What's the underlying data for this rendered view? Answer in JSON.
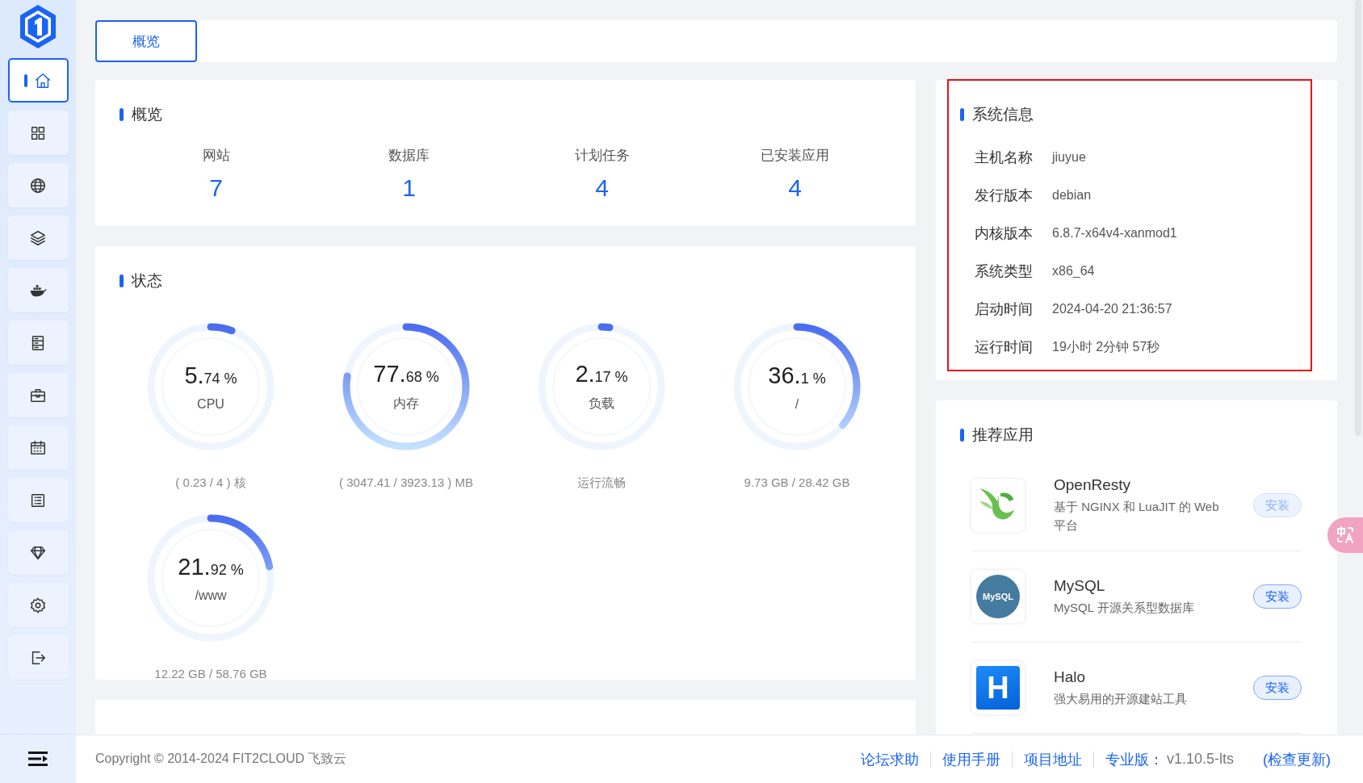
{
  "sidebar": {
    "items": [
      {
        "selected": true
      },
      {
        "selected": false
      },
      {
        "selected": false
      },
      {
        "selected": false
      },
      {
        "selected": false
      },
      {
        "selected": false
      },
      {
        "selected": false
      },
      {
        "selected": false
      },
      {
        "selected": false
      },
      {
        "selected": false
      },
      {
        "selected": false
      },
      {
        "selected": false
      }
    ]
  },
  "tabs": [
    {
      "label": "概览",
      "selected": true
    }
  ],
  "overview": {
    "title": "概览",
    "stats": [
      {
        "label": "网站",
        "value": "7"
      },
      {
        "label": "数据库",
        "value": "1"
      },
      {
        "label": "计划任务",
        "value": "4"
      },
      {
        "label": "已安装应用",
        "value": "4"
      }
    ]
  },
  "status": {
    "title": "状态",
    "gauges": [
      {
        "main": "5.",
        "fraction": "74 %",
        "label": "CPU",
        "detail": "( 0.23 / 4 ) 核",
        "level": 0.0574
      },
      {
        "main": "77.",
        "fraction": "68 %",
        "label": "内存",
        "detail": "( 3047.41 / 3923.13 ) MB",
        "level": 0.7768
      },
      {
        "main": "2.",
        "fraction": "17 %",
        "label": "负载",
        "detail": "运行流畅",
        "level": 0.0217
      },
      {
        "main": "36.",
        "fraction": "1 %",
        "label": "/",
        "detail": "9.73 GB / 28.42 GB",
        "level": 0.361
      },
      {
        "main": "21.",
        "fraction": "92 %",
        "label": "/www",
        "detail": "12.22 GB / 58.76 GB",
        "level": 0.2192
      }
    ]
  },
  "system_info": {
    "title": "系统信息",
    "highlighted": true,
    "rows": [
      {
        "label": "主机名称",
        "value": "jiuyue"
      },
      {
        "label": "发行版本",
        "value": "debian"
      },
      {
        "label": "内核版本",
        "value": "6.8.7-x64v4-xanmod1"
      },
      {
        "label": "系统类型",
        "value": "x86_64"
      },
      {
        "label": "启动时间",
        "value": "2024-04-20 21:36:57"
      },
      {
        "label": "运行时间",
        "value": "19小时 2分钟 57秒"
      }
    ]
  },
  "recommended": {
    "title": "推荐应用",
    "apps": [
      {
        "kind": "openresty",
        "name": "OpenResty",
        "description": "基于 NGINX 和 LuaJIT 的 Web 平台",
        "button": "安装",
        "disabled": true
      },
      {
        "kind": "mysql",
        "logo_text": "MySQL",
        "name": "MySQL",
        "description": "MySQL 开源关系型数据库",
        "button": "安装",
        "disabled": false
      },
      {
        "kind": "halo",
        "logo_text": "H",
        "name": "Halo",
        "description": "强大易用的开源建站工具",
        "button": "安装",
        "disabled": false
      }
    ]
  },
  "footer": {
    "copyright": "Copyright © 2014-2024 FIT2CLOUD 飞致云",
    "links": [
      "论坛求助",
      "使用手册",
      "项目地址"
    ],
    "edition": "专业版：",
    "version": "v1.10.5-lts",
    "update_link": "(检查更新)"
  }
}
